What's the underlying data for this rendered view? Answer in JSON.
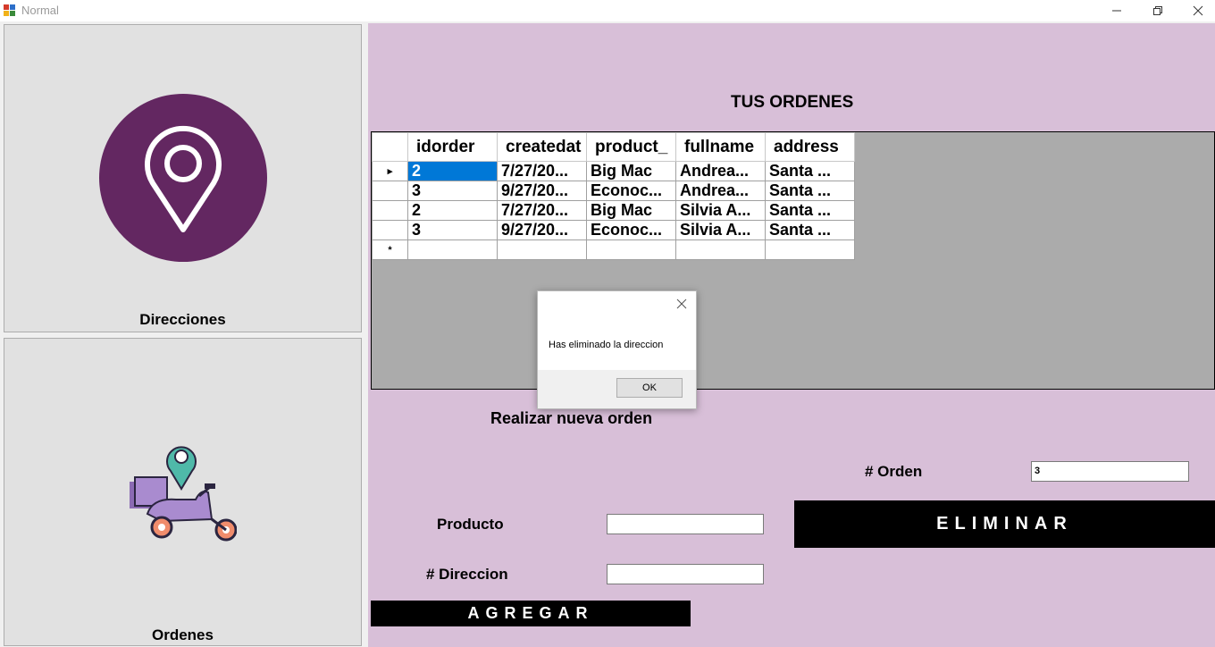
{
  "window": {
    "title": "Normal",
    "minimize_icon": "minimize-icon",
    "restore_icon": "restore-icon",
    "close_icon": "close-icon"
  },
  "left_panel": {
    "direcciones": {
      "label": "Direcciones",
      "icon": "location-pin-icon"
    },
    "ordenes": {
      "label": "Ordenes",
      "icon": "delivery-scooter-icon"
    }
  },
  "main": {
    "heading": "TUS ORDENES",
    "grid": {
      "columns": [
        "idorder",
        "createdat",
        "product_",
        "fullname",
        "address"
      ],
      "rows": [
        {
          "marker": "▸",
          "cells": [
            "2",
            "7/27/20...",
            "Big Mac",
            "Andrea...",
            "Santa ..."
          ]
        },
        {
          "marker": "",
          "cells": [
            "3",
            "9/27/20...",
            "Econoc...",
            "Andrea...",
            "Santa ..."
          ]
        },
        {
          "marker": "",
          "cells": [
            "2",
            "7/27/20...",
            "Big Mac",
            "Silvia A...",
            "Santa ..."
          ]
        },
        {
          "marker": "",
          "cells": [
            "3",
            "9/27/20...",
            "Econoc...",
            "Silvia A...",
            "Santa ..."
          ]
        }
      ],
      "new_row_marker": "*"
    },
    "new_order_heading": "Realizar nueva orden",
    "orden_label": "# Orden",
    "orden_value": "3",
    "eliminar_label": "ELIMINAR",
    "producto_label": "Producto",
    "producto_value": "",
    "direccion_label": "#  Direccion",
    "direccion_value": "",
    "agregar_label": "AGREGAR"
  },
  "messagebox": {
    "text": "Has eliminado la direccion",
    "ok_label": "OK"
  },
  "colors": {
    "panel_bg": "#d8bfd8",
    "pin_circle": "#632761",
    "selection": "#0078d7",
    "grid_bg": "#ababab"
  }
}
